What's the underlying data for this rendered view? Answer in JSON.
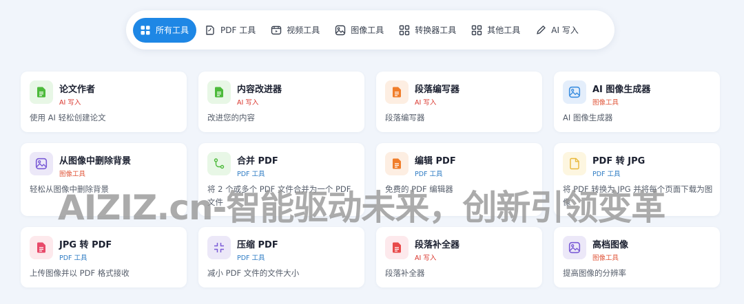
{
  "tabs": [
    {
      "label": "所有工具",
      "icon": "grid-icon",
      "active": true
    },
    {
      "label": "PDF 工具",
      "icon": "pdf-icon"
    },
    {
      "label": "视频工具",
      "icon": "video-icon"
    },
    {
      "label": "图像工具",
      "icon": "image-icon"
    },
    {
      "label": "转换器工具",
      "icon": "grid-icon"
    },
    {
      "label": "其他工具",
      "icon": "grid-icon"
    },
    {
      "label": "AI 写入",
      "icon": "pen-icon"
    }
  ],
  "cards": [
    {
      "title": "论文作者",
      "tag": "AI 写入",
      "desc": "使用 AI 轻松创建论文",
      "icon": "document-icon",
      "color": "#4cba3a"
    },
    {
      "title": "内容改进器",
      "tag": "AI 写入",
      "desc": "改进您的内容",
      "icon": "document-icon",
      "color": "#4cba3a"
    },
    {
      "title": "段落编写器",
      "tag": "AI 写入",
      "desc": "段落编写器",
      "icon": "document-icon",
      "color": "#f07d2a"
    },
    {
      "title": "AI 图像生成器",
      "tag": "图像工具",
      "desc": "AI 图像生成器",
      "icon": "image-icon",
      "color": "#3d8fe0"
    },
    {
      "title": "从图像中删除背景",
      "tag": "图像工具",
      "desc": "轻松从图像中删除背景",
      "icon": "image-icon",
      "color": "#7a5bd6"
    },
    {
      "title": "合并 PDF",
      "tag": "PDF 工具",
      "desc": "将 2 个或多个 PDF 文件合并为一个 PDF 文件",
      "icon": "merge-icon",
      "color": "#4cba3a"
    },
    {
      "title": "编辑 PDF",
      "tag": "PDF 工具",
      "desc": "免费的 PDF 编辑器",
      "icon": "document-icon",
      "color": "#f07d2a"
    },
    {
      "title": "PDF 转 JPG",
      "tag": "PDF 工具",
      "desc": "将 PDF 转换为 JPG 并将每个页面下载为图像",
      "icon": "file-icon",
      "color": "#e8b83a"
    },
    {
      "title": "JPG 转 PDF",
      "tag": "PDF 工具",
      "desc": "上传图像并以 PDF 格式接收",
      "icon": "document-icon",
      "color": "#e84a6a"
    },
    {
      "title": "压缩 PDF",
      "tag": "PDF 工具",
      "desc": "减小 PDF 文件的文件大小",
      "icon": "compress-icon",
      "color": "#7a5bd6"
    },
    {
      "title": "段落补全器",
      "tag": "AI 写入",
      "desc": "段落补全器",
      "icon": "document-icon",
      "color": "#e84a4a"
    },
    {
      "title": "高档图像",
      "tag": "图像工具",
      "desc": "提高图像的分辨率",
      "icon": "image-icon",
      "color": "#7a5bd6"
    }
  ],
  "tag_colors": {
    "AI 写入": "#d9342b",
    "图像工具": "#e0563a",
    "PDF 工具": "#2f7cc4"
  },
  "watermark": "AIZIZ.cn-智能驱动未来，创新引领变革"
}
